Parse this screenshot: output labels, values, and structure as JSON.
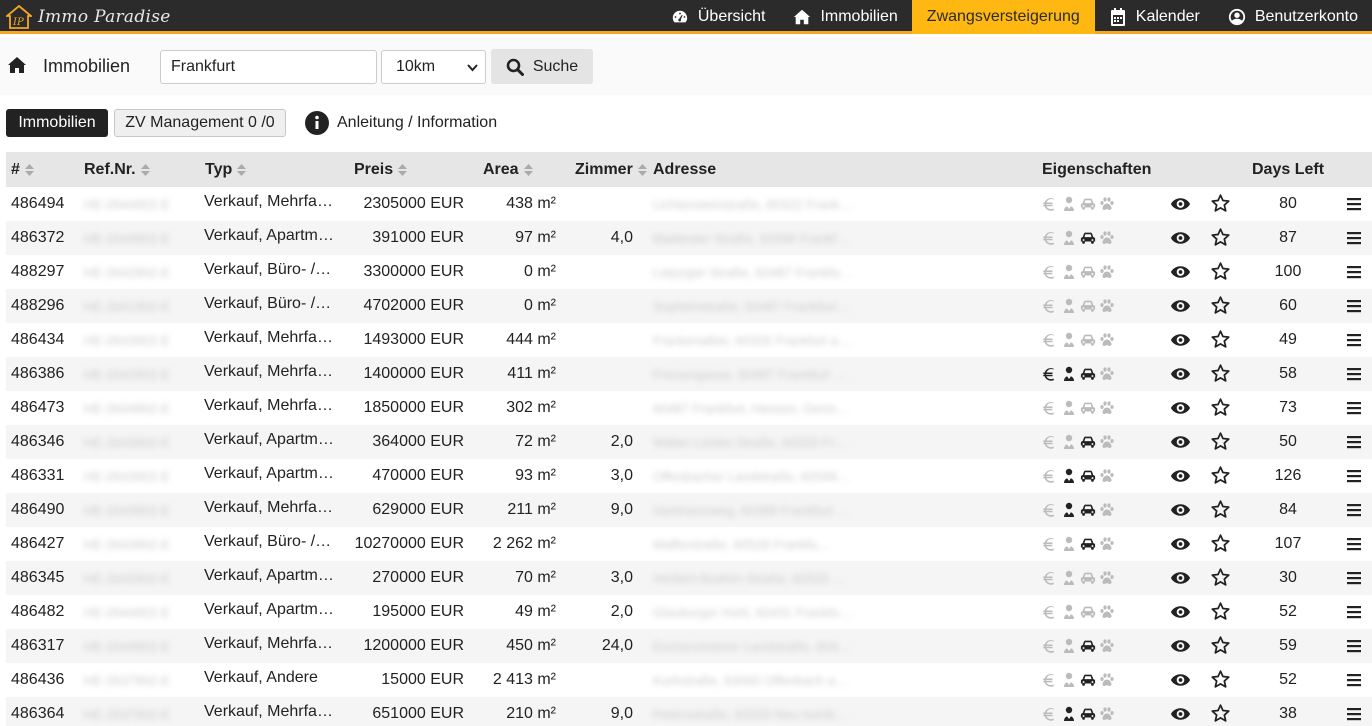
{
  "brand": {
    "name": "Immo Paradise"
  },
  "nav": [
    {
      "label": "Übersicht",
      "icon": "dashboard-icon",
      "active": false
    },
    {
      "label": "Immobilien",
      "icon": "home-icon",
      "active": false
    },
    {
      "label": "Zwangsversteigerung",
      "icon": "",
      "active": true
    },
    {
      "label": "Kalender",
      "icon": "calendar-icon",
      "active": false
    },
    {
      "label": "Benutzerkonto",
      "icon": "user-icon",
      "active": false
    }
  ],
  "search": {
    "title": "Immobilien",
    "location_value": "Frankfurt",
    "radius_value": "10km",
    "button_label": "Suche"
  },
  "toolbar": {
    "immobilien_label": "Immobilien",
    "zv_label": "ZV Management 0 /0",
    "info_label": "Anleitung / Information"
  },
  "table": {
    "headers": {
      "id": "#",
      "ref": "Ref.Nr.",
      "typ": "Typ",
      "preis": "Preis",
      "area": "Area",
      "zimmer": "Zimmer",
      "adresse": "Adresse",
      "eigenschaften": "Eigenschaften",
      "days_left": "Days Left"
    },
    "rows": [
      {
        "id": "486494",
        "ref": "HE-2644902-E",
        "typ": "Verkauf, Mehrfa…",
        "preis": "2305000 EUR",
        "area": "438 m²",
        "zimmer": "",
        "adresse": "Lichtensteinstraße, 60322 Frankf…",
        "props": [
          false,
          false,
          false,
          false
        ],
        "days": "80"
      },
      {
        "id": "486372",
        "ref": "HE-2644902-E",
        "typ": "Verkauf, Apartm…",
        "preis": "391000 EUR",
        "area": "97 m²",
        "zimmer": "4,0",
        "adresse": "Mailänder Straße, 60598 Frankf…",
        "props": [
          false,
          false,
          true,
          false
        ],
        "days": "87"
      },
      {
        "id": "488297",
        "ref": "HE-2642902-E",
        "typ": "Verkauf, Büro- /…",
        "preis": "3300000 EUR",
        "area": "0 m²",
        "zimmer": "",
        "adresse": "Leipziger Straße, 60487 Frankfu…",
        "props": [
          false,
          false,
          false,
          false
        ],
        "days": "100"
      },
      {
        "id": "488296",
        "ref": "HE-2641902-E",
        "typ": "Verkauf, Büro- /…",
        "preis": "4702000 EUR",
        "area": "0 m²",
        "zimmer": "",
        "adresse": "Sophienstraße, 60487 Frankfurt …",
        "props": [
          false,
          false,
          false,
          false
        ],
        "days": "60"
      },
      {
        "id": "486434",
        "ref": "HE-2643902-E",
        "typ": "Verkauf, Mehrfa…",
        "preis": "1493000 EUR",
        "area": "444 m²",
        "zimmer": "",
        "adresse": "Frankenallee, 60326 Frankfurt a…",
        "props": [
          false,
          false,
          false,
          false
        ],
        "days": "49"
      },
      {
        "id": "486386",
        "ref": "HE-2642902-E",
        "typ": "Verkauf, Mehrfa…",
        "preis": "1400000 EUR",
        "area": "411 m²",
        "zimmer": "",
        "adresse": "Friesengasse, 60487 Frankfurt a…",
        "props": [
          true,
          true,
          true,
          false
        ],
        "days": "58"
      },
      {
        "id": "486473",
        "ref": "HE-2644902-E",
        "typ": "Verkauf, Mehrfa…",
        "preis": "1850000 EUR",
        "area": "302 m²",
        "zimmer": "",
        "adresse": "60487 Frankfurt, Hessen, Germa…",
        "props": [
          false,
          false,
          false,
          false
        ],
        "days": "73"
      },
      {
        "id": "486346",
        "ref": "HE-2643902-E",
        "typ": "Verkauf, Apartm…",
        "preis": "364000 EUR",
        "area": "72 m²",
        "zimmer": "2,0",
        "adresse": "Walter-Leiske-Straße, 60320 Fra…",
        "props": [
          false,
          false,
          true,
          false
        ],
        "days": "50"
      },
      {
        "id": "486331",
        "ref": "HE-2643902-E",
        "typ": "Verkauf, Apartm…",
        "preis": "470000 EUR",
        "area": "93 m²",
        "zimmer": "3,0",
        "adresse": "Offenbacher Landstraße, 60599 …",
        "props": [
          false,
          true,
          true,
          false
        ],
        "days": "126"
      },
      {
        "id": "486490",
        "ref": "HE-2643902-E",
        "typ": "Verkauf, Mehrfa…",
        "preis": "629000 EUR",
        "area": "211 m²",
        "zimmer": "9,0",
        "adresse": "Hartmannweg, 60389 Frankfurt …",
        "props": [
          false,
          true,
          true,
          false
        ],
        "days": "84"
      },
      {
        "id": "486427",
        "ref": "HE-2643902-E",
        "typ": "Verkauf, Büro- /…",
        "preis": "10270000 EUR",
        "area": "2 262 m²",
        "zimmer": "",
        "adresse": "Mafferstraße, 60528 Frankfu…",
        "props": [
          false,
          false,
          true,
          false
        ],
        "days": "107"
      },
      {
        "id": "486345",
        "ref": "HE-2642902-E",
        "typ": "Verkauf, Apartm…",
        "preis": "270000 EUR",
        "area": "70 m²",
        "zimmer": "3,0",
        "adresse": "Herbert-Boehm-Straße, 60529 F…",
        "props": [
          false,
          false,
          false,
          false
        ],
        "days": "30"
      },
      {
        "id": "486482",
        "ref": "HE-2644902-E",
        "typ": "Verkauf, Apartm…",
        "preis": "195000 EUR",
        "area": "49 m²",
        "zimmer": "2,0",
        "adresse": "Glauburger Hohl, 60431 Frankfu…",
        "props": [
          false,
          false,
          false,
          false
        ],
        "days": "52"
      },
      {
        "id": "486317",
        "ref": "HE-2644902-E",
        "typ": "Verkauf, Mehrfa…",
        "preis": "1200000 EUR",
        "area": "450 m²",
        "zimmer": "24,0",
        "adresse": "Eschersheimer Landstraße, 604…",
        "props": [
          false,
          false,
          true,
          false
        ],
        "days": "59"
      },
      {
        "id": "486436",
        "ref": "HE-2637902-E",
        "typ": "Verkauf, Andere",
        "preis": "15000 EUR",
        "area": "2 413 m²",
        "zimmer": "",
        "adresse": "Kurhstraße, 63065 Offenbach am…",
        "props": [
          false,
          false,
          true,
          false
        ],
        "days": "52"
      },
      {
        "id": "486364",
        "ref": "HE-2637902-E",
        "typ": "Verkauf, Mehrfa…",
        "preis": "651000 EUR",
        "area": "210 m²",
        "zimmer": "9,0",
        "adresse": "Petersstraße, 63263 Neu-Isenbur…",
        "props": [
          false,
          true,
          true,
          false
        ],
        "days": "38"
      }
    ]
  },
  "colors": {
    "accent": "#ffb812",
    "navbar": "#2b2b2b",
    "prop_active": "#222222",
    "prop_inactive": "#bbbbbb"
  }
}
